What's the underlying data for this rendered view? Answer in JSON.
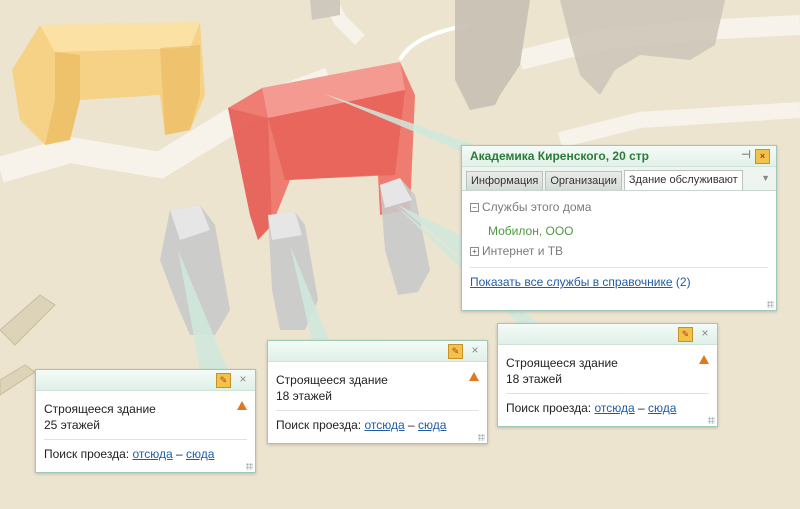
{
  "info_window": {
    "title": "Академика Киренского, 20 стр",
    "tabs": [
      "Информация",
      "Организации",
      "Здание обслуживают"
    ],
    "active_tab": 2,
    "section_services": "Службы этого дома",
    "service_org": "Мобилон, ООО",
    "section_internet": "Интернет и ТВ",
    "show_all_link": "Показать все службы в справочнике",
    "show_all_count": "(2)"
  },
  "building_popups": [
    {
      "title": "Строящееся здание",
      "floors": "25 этажей",
      "route_label": "Поиск проезда:",
      "from_link": "отсюда",
      "separator": "–",
      "to_link": "сюда"
    },
    {
      "title": "Строящееся здание",
      "floors": "18 этажей",
      "route_label": "Поиск проезда:",
      "from_link": "отсюда",
      "separator": "–",
      "to_link": "сюда"
    },
    {
      "title": "Строящееся здание",
      "floors": "18 этажей",
      "route_label": "Поиск проезда:",
      "from_link": "отсюда",
      "separator": "–",
      "to_link": "сюда"
    }
  ],
  "colors": {
    "map_background": "#ece4cf",
    "road": "#f7f3ea",
    "selected_building": "#ee7066",
    "yellow_building": "#f7cf79",
    "construction_building": "#c9c9c9",
    "popup_border": "#9fc9b6",
    "link": "#1f5ca6",
    "title_green": "#2c7a3a"
  }
}
